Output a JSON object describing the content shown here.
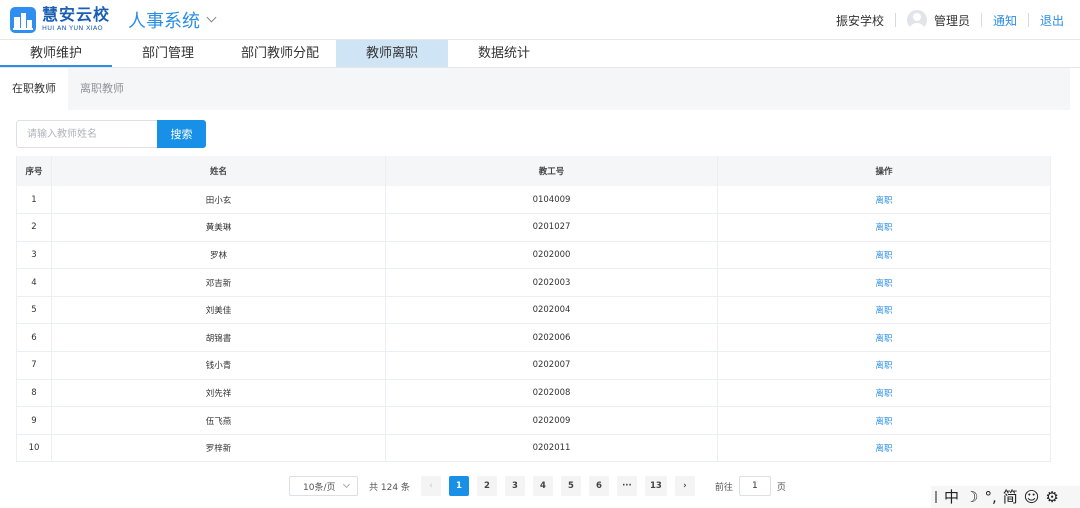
{
  "header": {
    "logo_cn": "慧安云校",
    "logo_en": "HUI AN YUN XIAO",
    "app_title": "人事系统",
    "school": "振安学校",
    "user": "管理员",
    "notice": "通知",
    "logout": "退出"
  },
  "nav": [
    {
      "label": "教师维护"
    },
    {
      "label": "部门管理"
    },
    {
      "label": "部门教师分配"
    },
    {
      "label": "教师离职"
    },
    {
      "label": "数据统计"
    }
  ],
  "subtabs": [
    {
      "label": "在职教师"
    },
    {
      "label": "离职教师"
    }
  ],
  "search": {
    "placeholder": "请输入教师姓名",
    "button": "搜索"
  },
  "table": {
    "columns": [
      "序号",
      "姓名",
      "教工号",
      "操作"
    ],
    "rows": [
      {
        "no": "1",
        "name": "田小玄",
        "id": "0104009",
        "action": "离职"
      },
      {
        "no": "2",
        "name": "黄美琳",
        "id": "0201027",
        "action": "离职"
      },
      {
        "no": "3",
        "name": "罗林",
        "id": "0202000",
        "action": "离职"
      },
      {
        "no": "4",
        "name": "邓吉新",
        "id": "0202003",
        "action": "离职"
      },
      {
        "no": "5",
        "name": "刘美佳",
        "id": "0202004",
        "action": "离职"
      },
      {
        "no": "6",
        "name": "胡锦書",
        "id": "0202006",
        "action": "离职"
      },
      {
        "no": "7",
        "name": "钱小青",
        "id": "0202007",
        "action": "离职"
      },
      {
        "no": "8",
        "name": "刘先祥",
        "id": "0202008",
        "action": "离职"
      },
      {
        "no": "9",
        "name": "伍飞燕",
        "id": "0202009",
        "action": "离职"
      },
      {
        "no": "10",
        "name": "罗梓新",
        "id": "0202011",
        "action": "离职"
      }
    ]
  },
  "pagination": {
    "page_size": "10条/页",
    "total": "共 124 条",
    "pages": [
      "1",
      "2",
      "3",
      "4",
      "5",
      "6",
      "···",
      "13"
    ],
    "prev": "‹",
    "next": "›",
    "goto_label": "前往",
    "goto_value": "1",
    "goto_unit": "页"
  },
  "ime": {
    "items": [
      "中",
      "☽",
      "°,",
      "简",
      "☺",
      "⚙"
    ]
  },
  "colors": {
    "accent": "#1890e8",
    "link": "#2c8ee6",
    "active_tab_bg": "#cfe4f5"
  }
}
